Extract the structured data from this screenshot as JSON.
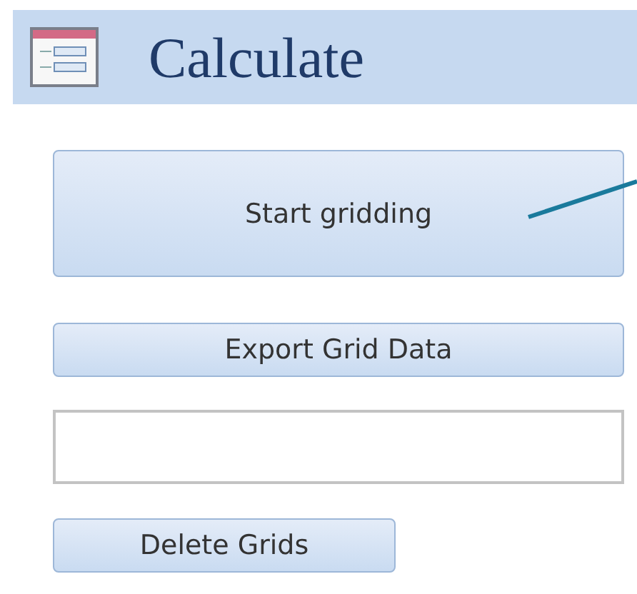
{
  "header": {
    "title": "Calculate"
  },
  "controls": [
    {
      "kind": "button",
      "label": "Start gridding"
    },
    {
      "kind": "button",
      "label": "Export Grid Data"
    },
    {
      "kind": "field"
    },
    {
      "kind": "button",
      "label": "Delete Grids"
    }
  ]
}
